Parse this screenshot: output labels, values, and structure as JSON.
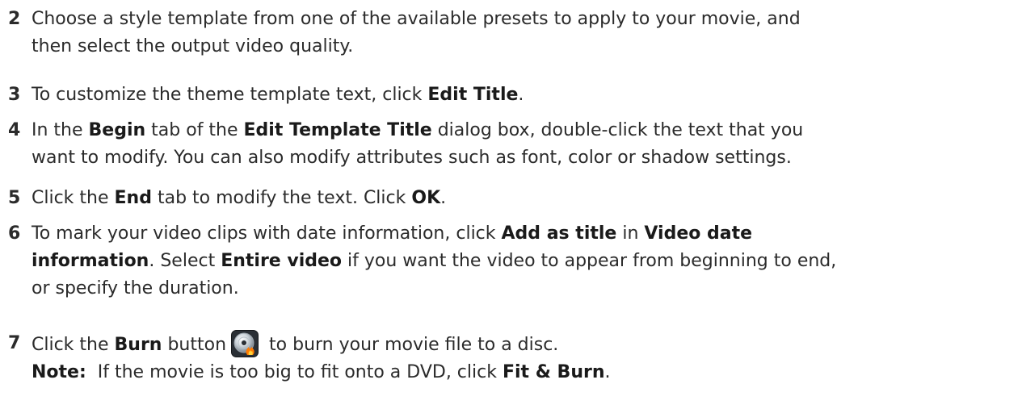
{
  "steps": [
    {
      "number": "2",
      "lines": [
        "Choose a style template from one of the available presets to apply to your movie, and",
        "then select the output video quality."
      ]
    },
    {
      "number": "3",
      "t1": "To customize the theme template text, click ",
      "b1": "Edit Title",
      "t2": "."
    },
    {
      "number": "4",
      "t1": "In the ",
      "b1": "Begin",
      "t2": " tab of the ",
      "b2": "Edit Template Title",
      "t3": " dialog box, double-click the text that you",
      "line2": "want to modify. You can also modify attributes such as font, color or shadow settings."
    },
    {
      "number": "5",
      "t1": "Click the ",
      "b1": "End",
      "t2": " tab to modify the text. Click ",
      "b2": "OK",
      "t3": "."
    },
    {
      "number": "6",
      "t1": "To mark your video clips with date information, click ",
      "b1": "Add as title",
      "t2": " in ",
      "b2": "Video date",
      "b3": "information",
      "t3": ". Select ",
      "b4": "Entire video",
      "t4": " if you want the video to appear from beginning to end,",
      "line3": "or specify the duration."
    },
    {
      "number": "7",
      "t1": "Click the ",
      "b1": "Burn",
      "t2": " button",
      "t3": " to burn your movie file to a disc.",
      "note_label": "Note:",
      "note_t1": "  If the movie is too big to fit onto a DVD, click ",
      "note_b1": "Fit & Burn",
      "note_t2": "."
    }
  ],
  "icons": {
    "burn": "burn-disc-icon"
  },
  "colors": {
    "text": "#2b2b2b",
    "flame": "#ff7a00"
  }
}
